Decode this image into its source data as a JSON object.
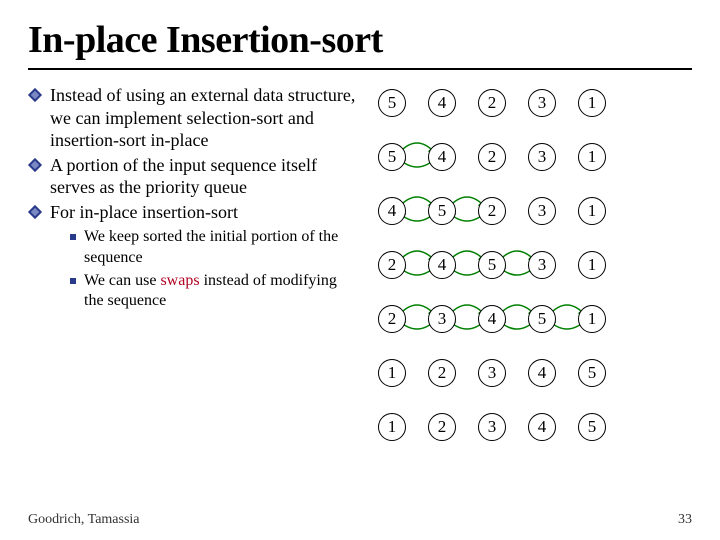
{
  "title": "In-place Insertion-sort",
  "bullets": [
    "Instead of using an external data structure, we can implement selection-sort and insertion-sort in-place",
    "A portion of the input sequence itself serves as the priority queue",
    "For in-place insertion-sort"
  ],
  "sub": [
    {
      "pre": "We keep sorted the initial portion of the sequence"
    },
    {
      "pre": "We can use ",
      "hl": "swaps",
      "post": " instead of modifying the sequence"
    }
  ],
  "footer": "Goodrich, Tamassia",
  "page": "33",
  "chart_data": {
    "type": "table",
    "title": "Insertion-sort steps",
    "rows": [
      {
        "values": [
          5,
          4,
          2,
          3,
          1
        ],
        "arcs": []
      },
      {
        "values": [
          5,
          4,
          2,
          3,
          1
        ],
        "arcs": [
          [
            0,
            1
          ]
        ]
      },
      {
        "values": [
          4,
          5,
          2,
          3,
          1
        ],
        "arcs": [
          [
            1,
            2
          ],
          [
            0,
            1
          ]
        ]
      },
      {
        "values": [
          2,
          4,
          5,
          3,
          1
        ],
        "arcs": [
          [
            2,
            3
          ],
          [
            1,
            2
          ],
          [
            0,
            1
          ]
        ]
      },
      {
        "values": [
          2,
          3,
          4,
          5,
          1
        ],
        "arcs": [
          [
            3,
            4
          ],
          [
            2,
            3
          ],
          [
            1,
            2
          ],
          [
            0,
            1
          ]
        ]
      },
      {
        "values": [
          1,
          2,
          3,
          4,
          5
        ],
        "arcs": []
      },
      {
        "values": [
          1,
          2,
          3,
          4,
          5
        ],
        "arcs": []
      }
    ]
  }
}
